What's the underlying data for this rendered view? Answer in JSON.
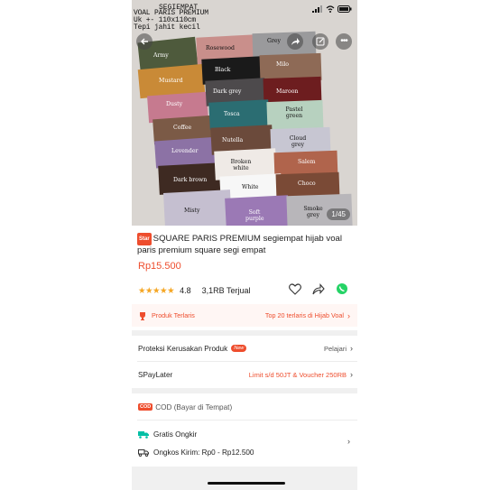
{
  "status_bar": {
    "time": "SEGIEMPAT"
  },
  "image": {
    "caption_lines": [
      "SEGIEMPAT",
      "VOAL PARIS PREMIUM",
      "Uk +- 110x110cm",
      "Tepi jahit kecil"
    ],
    "page_indicator": "1/45",
    "colors": [
      {
        "label": "Army",
        "hex": "#4e5a3c"
      },
      {
        "label": "Rosewood",
        "hex": "#c98f8b"
      },
      {
        "label": "Grey",
        "hex": "#9a9a9c"
      },
      {
        "label": "Mustard",
        "hex": "#c98a37"
      },
      {
        "label": "Black",
        "hex": "#1a1a1a"
      },
      {
        "label": "Milo",
        "hex": "#8e6a56"
      },
      {
        "label": "Dusty",
        "hex": "#c67a8f"
      },
      {
        "label": "Dark grey",
        "hex": "#4d4a4c"
      },
      {
        "label": "Maroon",
        "hex": "#6d1d1f"
      },
      {
        "label": "Coffee",
        "hex": "#7b5a46"
      },
      {
        "label": "Tosca",
        "hex": "#2b6d72"
      },
      {
        "label": "Pastel green",
        "hex": "#b7d1bf"
      },
      {
        "label": "Levender",
        "hex": "#8c72a5"
      },
      {
        "label": "Nutella",
        "hex": "#6b4a3b"
      },
      {
        "label": "Cloud grey",
        "hex": "#c7c6d2"
      },
      {
        "label": "Dark brown",
        "hex": "#3e2a22"
      },
      {
        "label": "Broken white",
        "hex": "#efeae6"
      },
      {
        "label": "Salem",
        "hex": "#b0644c"
      },
      {
        "label": "White",
        "hex": "#f7f7f7"
      },
      {
        "label": "Choco",
        "hex": "#7a4a36"
      },
      {
        "label": "Misty",
        "hex": "#c5bfd0"
      },
      {
        "label": "Soft purple",
        "hex": "#9b79b5"
      },
      {
        "label": "Smoke grey",
        "hex": "#b8b6ba"
      }
    ]
  },
  "product": {
    "badge": "Star",
    "title": "SQUARE PARIS PREMIUM segiempat hijab voal paris premium square segi empat",
    "price": "Rp15.500",
    "rating": "4.8",
    "sold": "3,1RB Terjual"
  },
  "best_seller": {
    "label": "Produk Terlaris",
    "detail": "Top 20 terlaris di Hijab Voal"
  },
  "protection": {
    "label": "Proteksi Kerusakan Produk",
    "badge": "New",
    "action": "Pelajari"
  },
  "spaylater": {
    "label": "SPayLater",
    "detail": "Limit s/d 50JT & Voucher 250RB"
  },
  "cod": {
    "badge": "COD",
    "label": "COD (Bayar di Tempat)"
  },
  "shipping": {
    "free_label": "Gratis Ongkir",
    "cost_label": "Ongkos Kirim: Rp0 - Rp12.500"
  },
  "accent_color": "#ee4d2d"
}
